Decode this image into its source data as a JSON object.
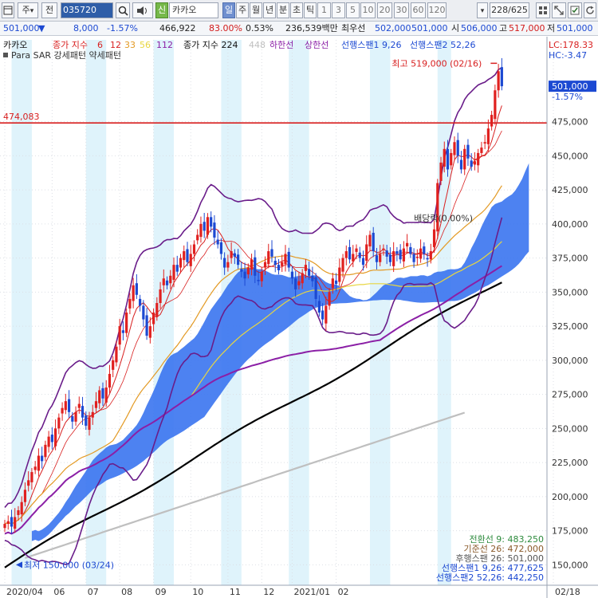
{
  "toolbar": {
    "frame_icon": "window-icon",
    "main_label": "주",
    "main_arrow": "▾",
    "before_label": "전",
    "code": "035720",
    "search_icon": "search-icon",
    "tool_icon": "speaker-icon",
    "new_label": "신",
    "stock_name": "카카오",
    "periods": [
      "일",
      "주",
      "월",
      "년",
      "분",
      "초",
      "틱",
      "1",
      "3",
      "5",
      "10",
      "20",
      "30",
      "60",
      "120"
    ],
    "selected_period": "일",
    "count_value": "228/625",
    "extra_icons": [
      "grid-icon",
      "resize-icon",
      "checkbox-icon",
      "refresh-icon"
    ]
  },
  "price_bar": {
    "price": "501,000",
    "change_arrow": "▼",
    "change": "8,000",
    "change_pct": "-1.57%",
    "volume": "466,922",
    "vol_ratio": "83.00%",
    "turnover": "0.53%",
    "amount": "236,539백만",
    "best_label": "최우선",
    "ask": "502,000",
    "bid": "501,000",
    "open_label": "시",
    "open": "506,000",
    "high_label": "고",
    "high": "517,000",
    "low_label": "저",
    "low": "501,000"
  },
  "chart": {
    "legend": {
      "name": "카카오",
      "ma_label": "종가 지수",
      "ma_periods": [
        "6",
        "12",
        "33",
        "56",
        "112"
      ],
      "ma_colors": [
        "#d81f1f",
        "#d81f1f",
        "#e39a24",
        "#e8d640",
        "#8b1fa6"
      ],
      "ma224_label": "종가 지수 224",
      "ma448": "448",
      "lower_band": "하한선",
      "upper_band": "상한선",
      "span1": "선행스팬1 9,26",
      "span2": "선행스팬2 52,26",
      "sar_line": "Para SAR 강세패턴  약세패턴"
    },
    "right_info": {
      "lc": "LC:178.33",
      "hc": "HC:-3.47",
      "last_price": "501,000",
      "last_pct": "-1.57%"
    },
    "ref_line": "474,083",
    "annotations": {
      "high": "최고 519,000 (02/16)",
      "low": "최저 150,000 (03/24)",
      "dividend": "배당락(0.00%)"
    },
    "ichimoku_summary": [
      {
        "label": "전환선 9: 483,250",
        "color": "#2e8b3e"
      },
      {
        "label": "기준선 26: 472,000",
        "color": "#8a5a2a"
      },
      {
        "label": "후행스팬 26: 501,000",
        "color": "#555555"
      },
      {
        "label": "선행스팬1 9,26: 477,625",
        "color": "#1c49d2"
      },
      {
        "label": "선행스팬2 52,26: 442,250",
        "color": "#1c49d2"
      }
    ],
    "colors": {
      "up": "#e0201f",
      "down": "#1c49d2",
      "cloud": "#3a74ef",
      "ma224": "#000000",
      "ma448": "#bfbfbf",
      "bollinger": "#6a1d8a",
      "ref": "#d81f1f",
      "shade": "#dff3fb"
    }
  },
  "chart_data": {
    "type": "candlestick",
    "title": "카카오",
    "ylim": [
      135000,
      535000
    ],
    "y_ticks": [
      150000,
      175000,
      200000,
      225000,
      250000,
      275000,
      300000,
      325000,
      350000,
      375000,
      400000,
      425000,
      450000,
      475000
    ],
    "x_labels": [
      "2020/04",
      "06",
      "07",
      "08",
      "09",
      "10",
      "11",
      "12",
      "2021/01",
      "02",
      "02/18"
    ],
    "reference_line": 474083,
    "series_markers": {
      "high": 519000,
      "low": 150000,
      "last": 501000
    },
    "closes": [
      180000,
      182000,
      178000,
      185000,
      190000,
      196000,
      205000,
      212000,
      218000,
      222000,
      230000,
      226000,
      238000,
      244000,
      240000,
      250000,
      258000,
      265000,
      270000,
      262000,
      255000,
      262000,
      268000,
      258000,
      252000,
      258000,
      262000,
      270000,
      278000,
      272000,
      280000,
      290000,
      300000,
      310000,
      325000,
      320000,
      335000,
      345000,
      355000,
      348000,
      340000,
      330000,
      318000,
      325000,
      335000,
      342000,
      352000,
      360000,
      355000,
      362000,
      370000,
      365000,
      375000,
      380000,
      372000,
      378000,
      385000,
      392000,
      400000,
      395000,
      405000,
      398000,
      390000,
      385000,
      378000,
      368000,
      372000,
      380000,
      376000,
      370000,
      365000,
      360000,
      368000,
      374000,
      362000,
      358000,
      365000,
      372000,
      380000,
      376000,
      370000,
      366000,
      372000,
      378000,
      368000,
      360000,
      352000,
      358000,
      364000,
      370000,
      362000,
      358000,
      345000,
      335000,
      330000,
      340000,
      350000,
      360000,
      356000,
      368000,
      375000,
      380000,
      374000,
      378000,
      382000,
      375000,
      370000,
      385000,
      392000,
      380000,
      372000,
      378000,
      382000,
      376000,
      372000,
      380000,
      378000,
      374000,
      382000,
      386000,
      378000,
      372000,
      376000,
      382000,
      378000,
      374000,
      380000,
      396000,
      430000,
      445000,
      455000,
      440000,
      452000,
      460000,
      450000,
      440000,
      455000,
      448000,
      442000,
      446000,
      452000,
      456000,
      460000,
      470000,
      480000,
      498000,
      512000,
      501000
    ]
  }
}
